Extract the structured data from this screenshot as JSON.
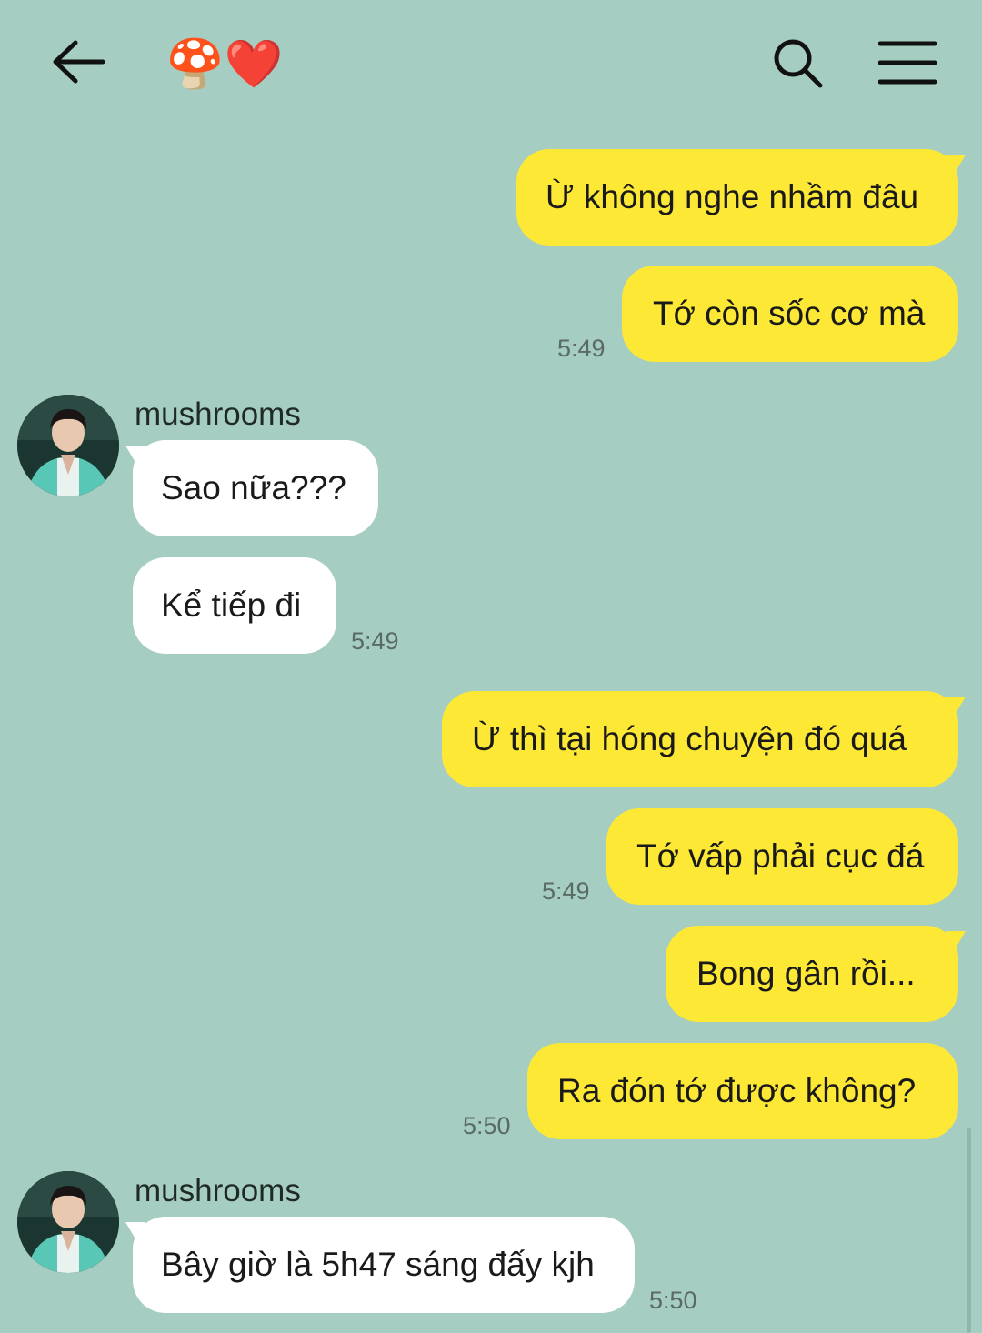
{
  "header": {
    "title_emoji": "🍄❤️",
    "back_icon": "arrow-left-icon",
    "search_icon": "search-icon",
    "menu_icon": "hamburger-menu-icon"
  },
  "colors": {
    "background": "#a6cdc1",
    "outgoing_bubble": "#fde836",
    "incoming_bubble": "#ffffff"
  },
  "messages": {
    "m1": {
      "text": "Ừ không nghe nhầm đâu"
    },
    "m2": {
      "text": "Tớ còn sốc cơ mà",
      "time": "5:49"
    },
    "g1": {
      "sender": "mushrooms"
    },
    "m3": {
      "text": "Sao nữa???"
    },
    "m4": {
      "text": "Kể tiếp đi",
      "time": "5:49"
    },
    "m5": {
      "text": "Ừ thì tại hóng chuyện đó quá"
    },
    "m6": {
      "text": "Tớ vấp phải cục đá",
      "time": "5:49"
    },
    "m7": {
      "text": "Bong gân rồi..."
    },
    "m8": {
      "text": "Ra đón tớ được không?",
      "time": "5:50"
    },
    "g2": {
      "sender": "mushrooms"
    },
    "m9": {
      "text": "Bây giờ là 5h47 sáng đấy kjh",
      "time": "5:50"
    }
  }
}
